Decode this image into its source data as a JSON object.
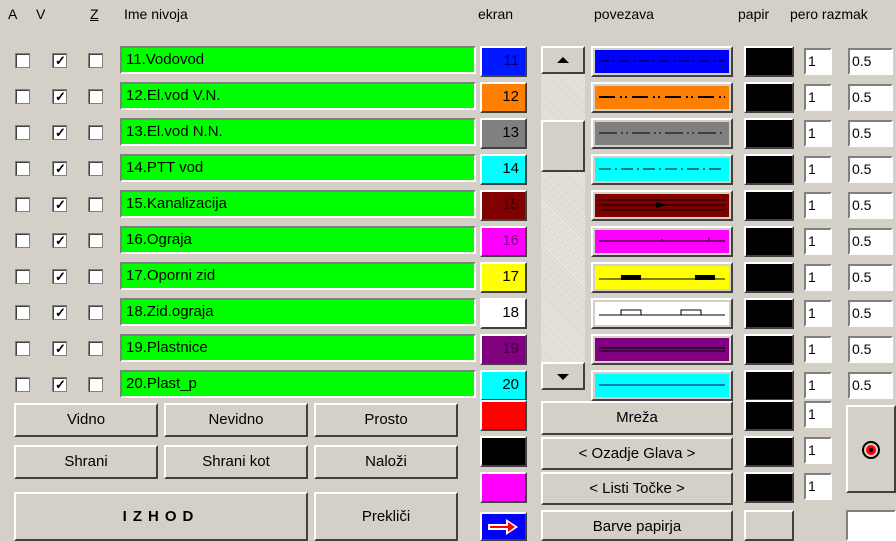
{
  "headers": {
    "a": "A",
    "v": "V",
    "z": "Z",
    "name": "Ime nivoja",
    "ekran": "ekran",
    "povezava": "povezava",
    "papir": "papir",
    "pero_razmak": "pero razmak"
  },
  "rows": [
    {
      "name": "11.Vodovod",
      "num": "11",
      "color": "#0018ff",
      "text_color": "#000080",
      "line_bg": "#0000ff",
      "pero": "1",
      "razmak": "0.5"
    },
    {
      "name": "12.El.vod V.N.",
      "num": "12",
      "color": "#ff8000",
      "text_color": "#000000",
      "line_bg": "#ff8000",
      "pero": "1",
      "razmak": "0.5"
    },
    {
      "name": "13.El.vod N.N.",
      "num": "13",
      "color": "#808080",
      "text_color": "#000000",
      "line_bg": "#808080",
      "pero": "1",
      "razmak": "0.5"
    },
    {
      "name": "14.PTT vod",
      "num": "14",
      "color": "#00ffff",
      "text_color": "#000000",
      "line_bg": "#00ffff",
      "pero": "1",
      "razmak": "0.5"
    },
    {
      "name": "15.Kanalizacija",
      "num": "15",
      "color": "#800000",
      "text_color": "#400000",
      "line_bg": "#800000",
      "pero": "1",
      "razmak": "0.5"
    },
    {
      "name": "16.Ograja",
      "num": "16",
      "color": "#ff00ff",
      "text_color": "#800080",
      "line_bg": "#ff00ff",
      "pero": "1",
      "razmak": "0.5"
    },
    {
      "name": "17.Oporni zid",
      "num": "17",
      "color": "#ffff00",
      "text_color": "#000000",
      "line_bg": "#ffff00",
      "pero": "1",
      "razmak": "0.5"
    },
    {
      "name": "18.Zid.ograja",
      "num": "18",
      "color": "#ffffff",
      "text_color": "#000000",
      "line_bg": "#ffffff",
      "pero": "1",
      "razmak": "0.5"
    },
    {
      "name": "19.Plastnice",
      "num": "19",
      "color": "#800080",
      "text_color": "#400040",
      "line_bg": "#800080",
      "pero": "1",
      "razmak": "0.5"
    },
    {
      "name": "20.Plast_p",
      "num": "20",
      "color": "#00ffff",
      "text_color": "#000000",
      "line_bg": "#00ffff",
      "pero": "1",
      "razmak": "0.5"
    }
  ],
  "buttons": {
    "vidno": "Vidno",
    "nevidno": "Nevidno",
    "prosto": "Prosto",
    "shrani": "Shrani",
    "shrani_kot": "Shrani kot",
    "nalozi": "Naloži",
    "izhod": "IZHOD",
    "preklici": "Prekliči",
    "mreza": "Mreža",
    "ozadje_glava": "< Ozadje  Glava >",
    "listi_tocke": "< Listi  Točke >",
    "barve_papirja": "Barve papirja"
  },
  "extra_colors": [
    "#ff0000",
    "#000000",
    "#ff00ff"
  ],
  "extra_pero": [
    "1",
    "1",
    "1"
  ],
  "icons": {
    "scroll_up": "arrow-up-icon",
    "scroll_down": "arrow-down-icon",
    "swap": "arrow-right-icon",
    "target": "target-icon"
  }
}
